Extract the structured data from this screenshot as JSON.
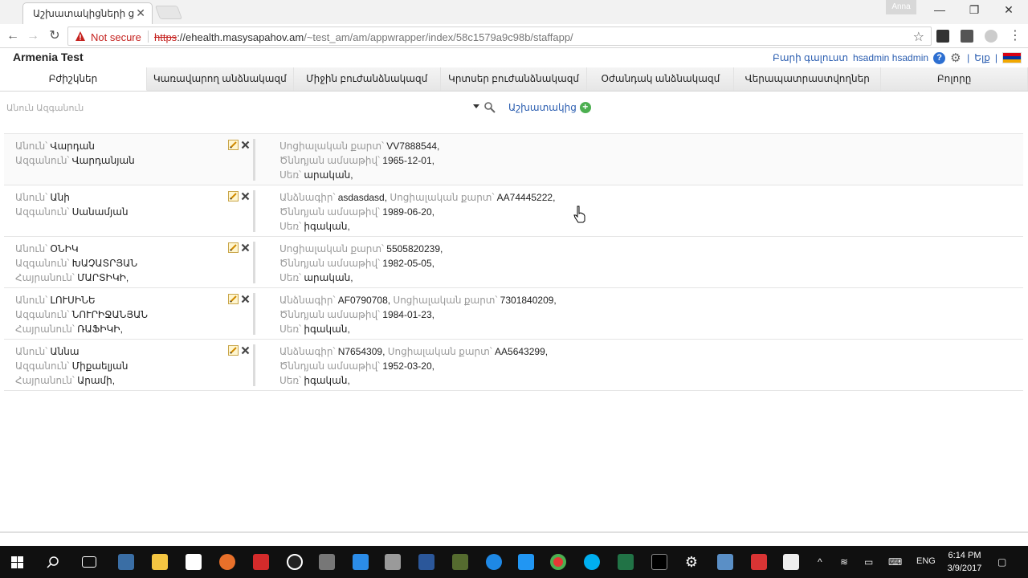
{
  "browser": {
    "tab_title": "Աշխատակիցների ցուց",
    "profile_name": "Anna",
    "not_secure": "Not secure",
    "url_scheme": "https",
    "url_host": "://ehealth.masysapahov.am",
    "url_path": "/~test_am/am/appwrapper/index/58c1579a9c98b/staffapp/"
  },
  "app": {
    "brand": "Armenia Test",
    "welcome": "Բարի գալուստ",
    "user": "hsadmin hsadmin",
    "pipe1": "|",
    "logout": "Ելք",
    "pipe2": "|"
  },
  "tabs": [
    {
      "label": "Բժիշկներ",
      "active": true
    },
    {
      "label": "Կառավարող անձնակազմ"
    },
    {
      "label": "Միջին բուժանձնակազմ"
    },
    {
      "label": "Կրտսեր բուժանձնակազմ"
    },
    {
      "label": "Օժանդակ անձնակազմ"
    },
    {
      "label": "Վերապատրաստվողներ"
    },
    {
      "label": "Բոլորը"
    }
  ],
  "search": {
    "placeholder": "Անուն Ազգանուն",
    "add_label": "Աշխատակից"
  },
  "staff": [
    {
      "l1_label": "Անուն՝ ",
      "l1_value": "Վարդան",
      "l2_label": "Ազգանուն՝ ",
      "l2_value": "Վարդանյան",
      "l3_label": "",
      "l3_value": "",
      "r1a_label": "",
      "r1a_value": "",
      "r1b_label": "Սոցիալական քարտ՝ ",
      "r1b_value": "VV7888544,",
      "r2_label": "Ծննդյան ամսաթիվ՝ ",
      "r2_value": "1965-12-01,",
      "r3_label": "Սեռ՝ ",
      "r3_value": "արական,"
    },
    {
      "l1_label": "Անուն՝ ",
      "l1_value": "Անի",
      "l2_label": "Ազգանուն՝ ",
      "l2_value": "Սանամյան",
      "l3_label": "",
      "l3_value": "",
      "r1a_label": "Անձնագիր՝ ",
      "r1a_value": "asdasdasd, ",
      "r1b_label": "Սոցիալական քարտ՝ ",
      "r1b_value": "AA74445222,",
      "r2_label": "Ծննդյան ամսաթիվ՝ ",
      "r2_value": "1989-06-20,",
      "r3_label": "Սեռ՝ ",
      "r3_value": "իգական,"
    },
    {
      "l1_label": "Անուն՝ ",
      "l1_value": "ՕՆԻԿ",
      "l2_label": "Ազգանուն՝ ",
      "l2_value": "ԽԱՉԱՏՐՅԱՆ",
      "l3_label": "Հայրանուն՝ ",
      "l3_value": "ՄԱՐՏԻԿԻ,",
      "r1a_label": "",
      "r1a_value": "",
      "r1b_label": "Սոցիալական քարտ՝ ",
      "r1b_value": "5505820239,",
      "r2_label": "Ծննդյան ամսաթիվ՝ ",
      "r2_value": "1982-05-05,",
      "r3_label": "Սեռ՝ ",
      "r3_value": "արական,"
    },
    {
      "l1_label": "Անուն՝ ",
      "l1_value": "ԼՈՒՍԻՆԵ",
      "l2_label": "Ազգանուն՝ ",
      "l2_value": "ՆՈՒՐԻՋԱՆՅԱՆ",
      "l3_label": "Հայրանուն՝ ",
      "l3_value": "ՌԱՖԻԿԻ,",
      "r1a_label": "Անձնագիր՝ ",
      "r1a_value": "AF0790708, ",
      "r1b_label": "Սոցիալական քարտ՝ ",
      "r1b_value": "7301840209,",
      "r2_label": "Ծննդյան ամսաթիվ՝ ",
      "r2_value": "1984-01-23,",
      "r3_label": "Սեռ՝ ",
      "r3_value": "իգական,"
    },
    {
      "l1_label": "Անուն՝ ",
      "l1_value": "Աննա",
      "l2_label": "Ազգանուն՝ ",
      "l2_value": "Միքաելյան",
      "l3_label": "Հայրանուն՝ ",
      "l3_value": "Արամի,",
      "r1a_label": "Անձնագիր՝ ",
      "r1a_value": "N7654309, ",
      "r1b_label": "Սոցիալական քարտ՝ ",
      "r1b_value": "AA5643299,",
      "r2_label": "Ծննդյան ամսաթիվ՝ ",
      "r2_value": "1952-03-20,",
      "r3_label": "Սեռ՝ ",
      "r3_value": "իգական,"
    }
  ],
  "taskbar": {
    "lang": "ENG",
    "time": "6:14 PM",
    "date": "3/9/2017"
  },
  "colors": {
    "link": "#2a5db0",
    "warning": "#c5221f",
    "add": "#4caf50"
  }
}
